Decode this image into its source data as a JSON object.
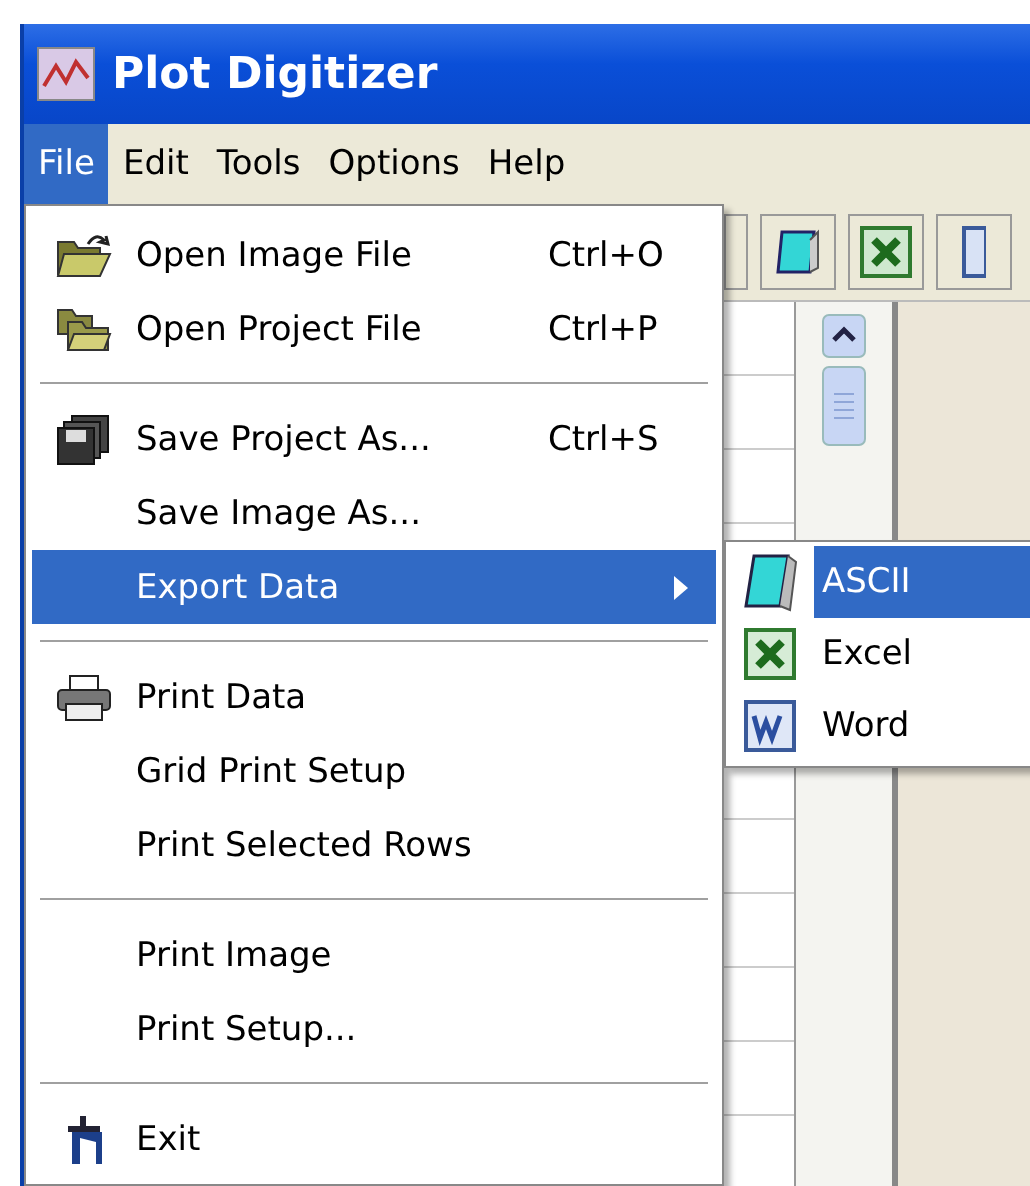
{
  "window": {
    "title": "Plot Digitizer"
  },
  "menubar": [
    {
      "label": "File",
      "selected": true
    },
    {
      "label": "Edit",
      "selected": false
    },
    {
      "label": "Tools",
      "selected": false
    },
    {
      "label": "Options",
      "selected": false
    },
    {
      "label": "Help",
      "selected": false
    }
  ],
  "file_menu": [
    {
      "kind": "item",
      "label": "Open Image File",
      "shortcut": "Ctrl+O",
      "selected": false
    },
    {
      "kind": "item",
      "label": "Open Project File",
      "shortcut": "Ctrl+P",
      "selected": false
    },
    {
      "kind": "separator"
    },
    {
      "kind": "item",
      "label": "Save Project As...",
      "shortcut": "Ctrl+S",
      "selected": false
    },
    {
      "kind": "item",
      "label": "Save Image As...",
      "selected": false
    },
    {
      "kind": "submenu",
      "label": "Export Data",
      "selected": true
    },
    {
      "kind": "separator"
    },
    {
      "kind": "item",
      "label": "Print Data",
      "selected": false
    },
    {
      "kind": "item",
      "label": "Grid Print Setup",
      "selected": false
    },
    {
      "kind": "item",
      "label": "Print Selected Rows",
      "selected": false
    },
    {
      "kind": "separator"
    },
    {
      "kind": "item",
      "label": "Print Image",
      "selected": false
    },
    {
      "kind": "item",
      "label": "Print Setup...",
      "selected": false
    },
    {
      "kind": "separator"
    },
    {
      "kind": "item",
      "label": "Exit",
      "selected": false
    }
  ],
  "export_submenu": [
    {
      "label": "ASCII",
      "selected": true
    },
    {
      "label": "Excel",
      "selected": false
    },
    {
      "label": "Word",
      "selected": false
    }
  ]
}
